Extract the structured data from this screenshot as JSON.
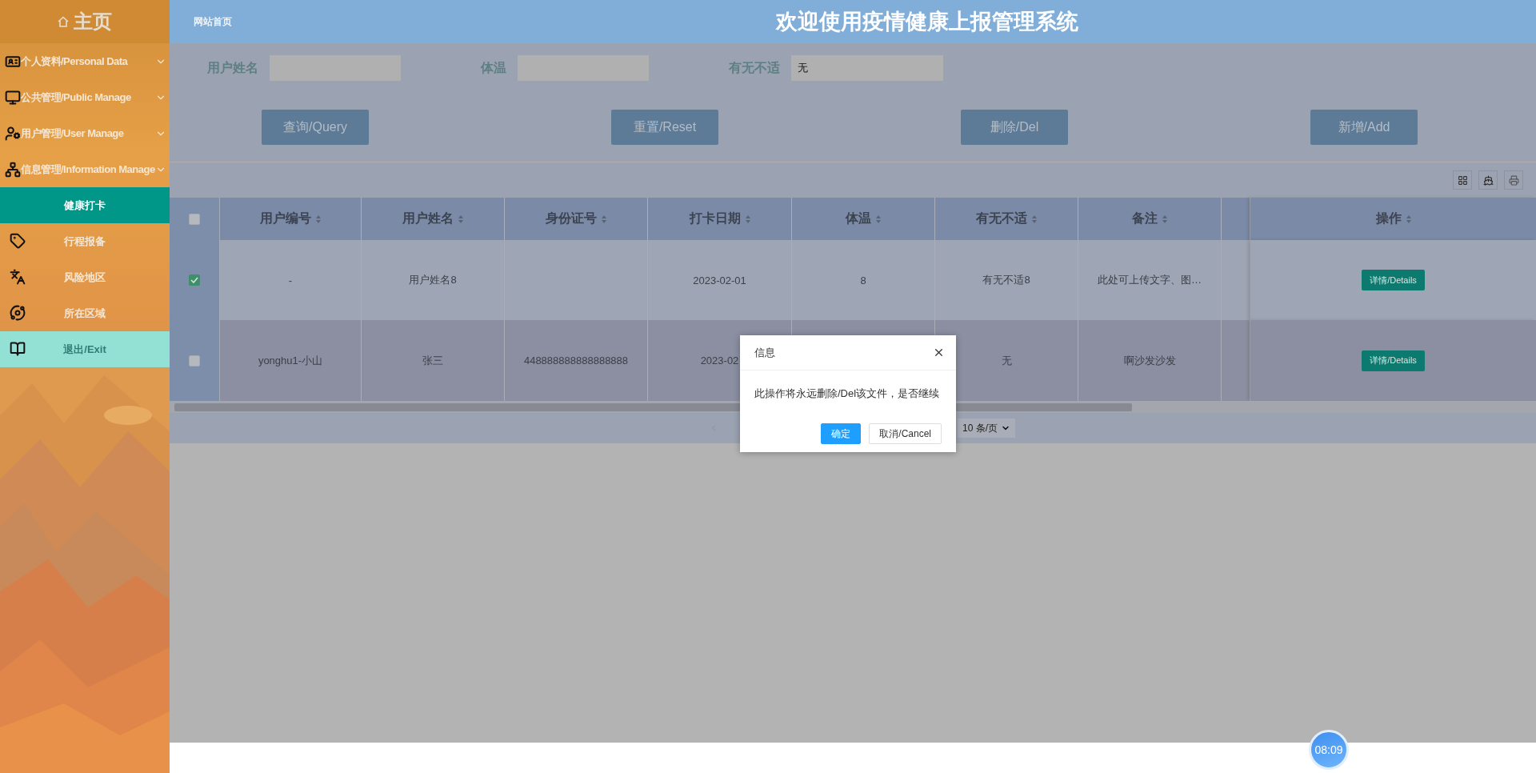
{
  "sidebar": {
    "title": "主页",
    "items": [
      {
        "label": "个人资料/Personal Data",
        "kind": "menu",
        "selected": false
      },
      {
        "label": "公共管理/Public Manage",
        "kind": "menu",
        "selected": false
      },
      {
        "label": "用户管理/User Manage",
        "kind": "menu",
        "selected": false
      },
      {
        "label": "信息管理/Information Manage",
        "kind": "menu",
        "selected": false
      },
      {
        "label": "健康打卡",
        "kind": "sub",
        "selected": true
      },
      {
        "label": "行程报备",
        "kind": "sub",
        "selected": false
      },
      {
        "label": "风险地区",
        "kind": "sub",
        "selected": false
      },
      {
        "label": "所在区域",
        "kind": "sub",
        "selected": false
      },
      {
        "label": "退出/Exit",
        "kind": "exit",
        "selected": false
      }
    ]
  },
  "header": {
    "breadcrumb": "网站首页",
    "title": "欢迎使用疫情健康上报管理系统"
  },
  "search": {
    "fields": [
      {
        "label": "用户姓名"
      },
      {
        "label": "体温"
      },
      {
        "label": "有无不适",
        "value": "无"
      }
    ],
    "buttons": [
      "查询/Query",
      "重置/Reset",
      "删除/Del",
      "新增/Add"
    ]
  },
  "table": {
    "select_all_checked": false,
    "columns": [
      "用户编号",
      "用户姓名",
      "身份证号",
      "打卡日期",
      "体温",
      "有无不适",
      "备注",
      "",
      "操作"
    ],
    "rows": [
      {
        "checked": true,
        "highlighted": false,
        "cells": [
          "-",
          "用户姓名8",
          "",
          "2023-02-01",
          "8",
          "有无不适8",
          "此处可上传文字、图…"
        ],
        "action": "详情/Details"
      },
      {
        "checked": false,
        "highlighted": true,
        "cells": [
          "yonghu1-小山",
          "张三",
          "448888888888888888",
          "2023-02",
          "",
          "无",
          "啊沙发沙发"
        ],
        "action": "详情/Details"
      }
    ]
  },
  "pagination": {
    "page_size": "10 条/页"
  },
  "dialog": {
    "title": "信息",
    "message": "此操作将永远删除/Del该文件，是否继续",
    "buttons": [
      {
        "label": "确定",
        "primary": true
      },
      {
        "label": "取消/Cancel",
        "primary": false
      }
    ]
  },
  "clock": "08:09"
}
